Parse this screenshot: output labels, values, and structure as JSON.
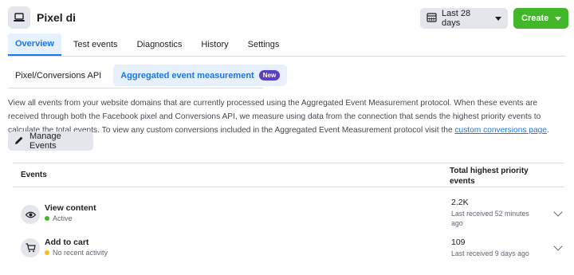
{
  "header": {
    "pixel_name": "Pixel di",
    "date_range": "Last 28 days",
    "create_label": "Create",
    "accent": "#1877f2",
    "create_color": "#42b72a"
  },
  "tabs": [
    {
      "label": "Overview",
      "active": true
    },
    {
      "label": "Test events",
      "active": false
    },
    {
      "label": "Diagnostics",
      "active": false
    },
    {
      "label": "History",
      "active": false
    },
    {
      "label": "Settings",
      "active": false
    }
  ],
  "subtabs": [
    {
      "label": "Pixel/Conversions API",
      "active": false
    },
    {
      "label": "Aggregated event measurement",
      "active": true,
      "badge": "New"
    }
  ],
  "description": {
    "text": "View all events from your website domains that are currently processed using the Aggregated Event Measurement protocol. When these events are received through both the Facebook pixel and Conversions API, we measure using data from the connection that sends the highest priority events to calculate the total events. To view any custom conversions included in the Aggregated Event Measurement protocol visit the ",
    "link": "custom conversions page",
    "end": "."
  },
  "manage_button": "Manage Events",
  "table": {
    "col_events": "Events",
    "col_total": "Total highest priority events",
    "rows": [
      {
        "icon": "eye-icon",
        "name": "View content",
        "status": "Active",
        "status_color": "#42b72a",
        "value": "2.2K",
        "received": "Last received 52 minutes ago"
      },
      {
        "icon": "cart-icon",
        "name": "Add to cart",
        "status": "No recent activity",
        "status_color": "#f7b928",
        "value": "109",
        "received": "Last received 9 days ago"
      }
    ]
  }
}
